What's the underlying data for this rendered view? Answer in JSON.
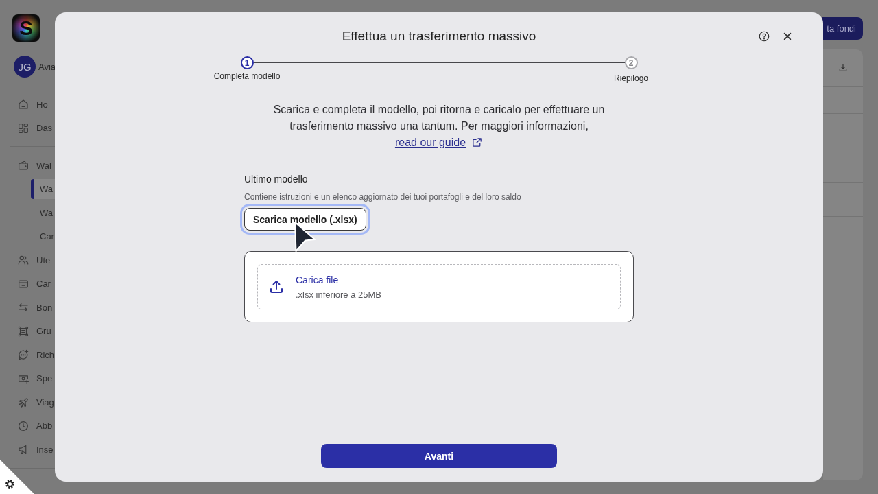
{
  "app": {
    "logo": {
      "letter": "S"
    },
    "user": {
      "initials": "JG",
      "name": "Avia"
    },
    "sidebar": {
      "sections": [
        {
          "items": [
            {
              "label": "Ho",
              "selected": false
            },
            {
              "label": "Das",
              "selected": false
            }
          ]
        },
        {
          "items": [
            {
              "label": "Wal",
              "selected": false,
              "children": [
                {
                  "label": "Wa",
                  "selected": true
                },
                {
                  "label": "Wa",
                  "selected": false
                },
                {
                  "label": "Car",
                  "selected": false
                }
              ]
            },
            {
              "label": "Ute",
              "selected": false
            },
            {
              "label": "Car",
              "selected": false
            },
            {
              "label": "Bon",
              "selected": false
            },
            {
              "label": "Gru",
              "selected": false
            },
            {
              "label": "Rich",
              "selected": false
            },
            {
              "label": "Spe",
              "selected": false
            },
            {
              "label": "Viag",
              "selected": false
            },
            {
              "label": "Abb",
              "selected": false
            },
            {
              "label": "Inse",
              "selected": false
            }
          ]
        }
      ]
    },
    "top_button": {
      "label": "ta fondi"
    }
  },
  "modal": {
    "title": "Effettua un trasferimento massivo",
    "steps": [
      {
        "number": "1",
        "label": "Completa modello",
        "selected": true
      },
      {
        "number": "2",
        "label": "Riepilogo",
        "selected": false
      }
    ],
    "intro": {
      "text": "Scarica e completa il modello, poi ritorna e caricalo per effettuare un trasferimento massivo una tantum. Per maggiori informazioni,",
      "link": "read our guide"
    },
    "template": {
      "title": "Ultimo modello",
      "hint": "Contiene istruzioni e un elenco aggiornato dei tuoi portafogli e del loro saldo",
      "button": {
        "label": "Scarica modello (.xlsx)",
        "focused": true
      }
    },
    "upload": {
      "label": "Carica file",
      "hint": ".xlsx inferiore a 25MB"
    },
    "primary_button": {
      "label": "Avanti"
    }
  }
}
